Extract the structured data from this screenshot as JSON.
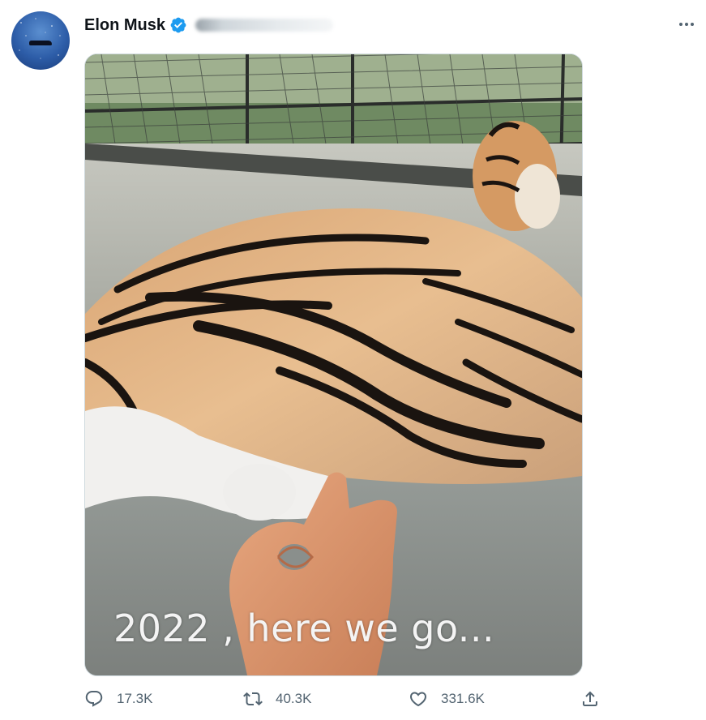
{
  "author": {
    "name": "Elon Musk",
    "verified": true,
    "icons": {
      "avatar": "avatar-image",
      "verified": "verified-badge-icon"
    }
  },
  "menu": {
    "icon": "more-horizontal-icon"
  },
  "media": {
    "description_icon": "photo-tiger-hand",
    "caption": "2022 , here we go..."
  },
  "actions": {
    "reply": {
      "count": "17.3K",
      "icon": "reply-icon"
    },
    "retweet": {
      "count": "40.3K",
      "icon": "retweet-icon"
    },
    "like": {
      "count": "331.6K",
      "icon": "heart-icon"
    },
    "share": {
      "icon": "share-icon"
    }
  },
  "colors": {
    "verified": "#1d9bf0",
    "meta_text": "#536471",
    "border": "#cfd9de"
  }
}
